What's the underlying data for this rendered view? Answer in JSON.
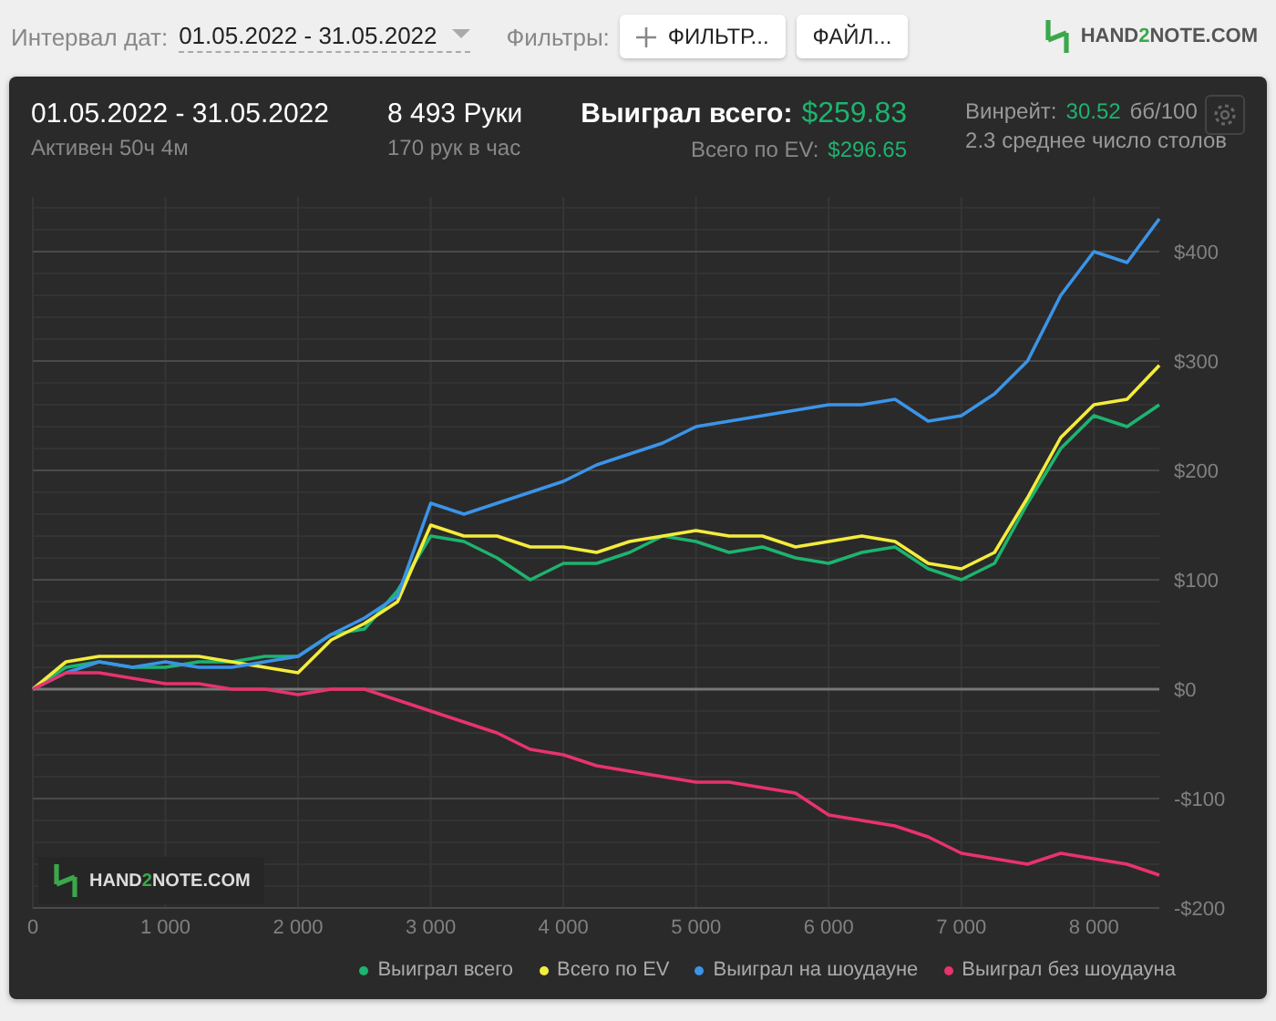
{
  "toolbar": {
    "date_label": "Интервал дат:",
    "date_range": "01.05.2022 - 31.05.2022",
    "filters_label": "Фильтры:",
    "buttons": [
      {
        "label": "ФИЛЬТР...",
        "kind": "add"
      },
      {
        "label": "ФАЙЛ...",
        "kind": "plain"
      }
    ],
    "logo": {
      "start": "HAND",
      "accent": "2",
      "end": "NOTE.COM"
    }
  },
  "summary": {
    "period": "01.05.2022 - 31.05.2022",
    "active": "Активен 50ч 4м",
    "hands": "8 493 Руки",
    "hands_rate": "170 рук в час",
    "won_label": "Выиграл всего:",
    "won_value": "$259.83",
    "ev_label": "Всего по EV:",
    "ev_value": "$296.65",
    "winrate_label": "Винрейт:",
    "winrate_value": "30.52",
    "winrate_unit": "бб/100",
    "tables": "2.3 среднее число столов"
  },
  "chart": {
    "watermark": {
      "start": "HAND",
      "accent": "2",
      "end": "NOTE.COM"
    },
    "chart_data": {
      "type": "line",
      "x": [
        0,
        250,
        500,
        750,
        1000,
        1250,
        1500,
        1750,
        2000,
        2250,
        2500,
        2750,
        3000,
        3250,
        3500,
        3750,
        4000,
        4250,
        4500,
        4750,
        5000,
        5250,
        5500,
        5750,
        6000,
        6250,
        6500,
        6750,
        7000,
        7250,
        7500,
        7750,
        8000,
        8250,
        8493
      ],
      "series": [
        {
          "name": "Выиграл всего",
          "color": "#1db46f",
          "values": [
            0,
            20,
            25,
            20,
            20,
            25,
            25,
            30,
            30,
            50,
            55,
            90,
            140,
            135,
            120,
            100,
            115,
            115,
            125,
            140,
            135,
            125,
            130,
            120,
            115,
            125,
            130,
            110,
            100,
            115,
            170,
            220,
            250,
            240,
            260
          ]
        },
        {
          "name": "Всего по EV",
          "color": "#f4ec3c",
          "values": [
            0,
            25,
            30,
            30,
            30,
            30,
            25,
            20,
            15,
            45,
            60,
            80,
            150,
            140,
            140,
            130,
            130,
            125,
            135,
            140,
            145,
            140,
            140,
            130,
            135,
            140,
            135,
            115,
            110,
            125,
            175,
            230,
            260,
            265,
            296
          ]
        },
        {
          "name": "Выиграл на шоудауне",
          "color": "#3b94e8",
          "values": [
            0,
            15,
            25,
            20,
            25,
            20,
            20,
            25,
            30,
            50,
            65,
            85,
            170,
            160,
            170,
            180,
            190,
            205,
            215,
            225,
            240,
            245,
            250,
            255,
            260,
            260,
            265,
            245,
            250,
            270,
            300,
            360,
            400,
            390,
            430
          ]
        },
        {
          "name": "Выиграл без шоудауна",
          "color": "#e8336c",
          "values": [
            0,
            15,
            15,
            10,
            5,
            5,
            0,
            0,
            -5,
            0,
            0,
            -10,
            -20,
            -30,
            -40,
            -55,
            -60,
            -70,
            -75,
            -80,
            -85,
            -85,
            -90,
            -95,
            -115,
            -120,
            -125,
            -135,
            -150,
            -155,
            -160,
            -150,
            -155,
            -160,
            -170
          ]
        }
      ],
      "grid": true,
      "xlim": [
        0,
        8493
      ],
      "ylim": [
        -200,
        450
      ],
      "xticks": [
        {
          "value": 0,
          "label": "0"
        },
        {
          "value": 1000,
          "label": "1 000"
        },
        {
          "value": 2000,
          "label": "2 000"
        },
        {
          "value": 3000,
          "label": "3 000"
        },
        {
          "value": 4000,
          "label": "4 000"
        },
        {
          "value": 5000,
          "label": "5 000"
        },
        {
          "value": 6000,
          "label": "6 000"
        },
        {
          "value": 7000,
          "label": "7 000"
        },
        {
          "value": 8000,
          "label": "8 000"
        }
      ],
      "yticks": [
        {
          "value": 400,
          "label": "$400"
        },
        {
          "value": 300,
          "label": "$300"
        },
        {
          "value": 200,
          "label": "$200"
        },
        {
          "value": 100,
          "label": "$100"
        },
        {
          "value": 0,
          "label": "$0"
        },
        {
          "value": -100,
          "label": "-$100"
        },
        {
          "value": -200,
          "label": "-$200"
        }
      ]
    }
  }
}
